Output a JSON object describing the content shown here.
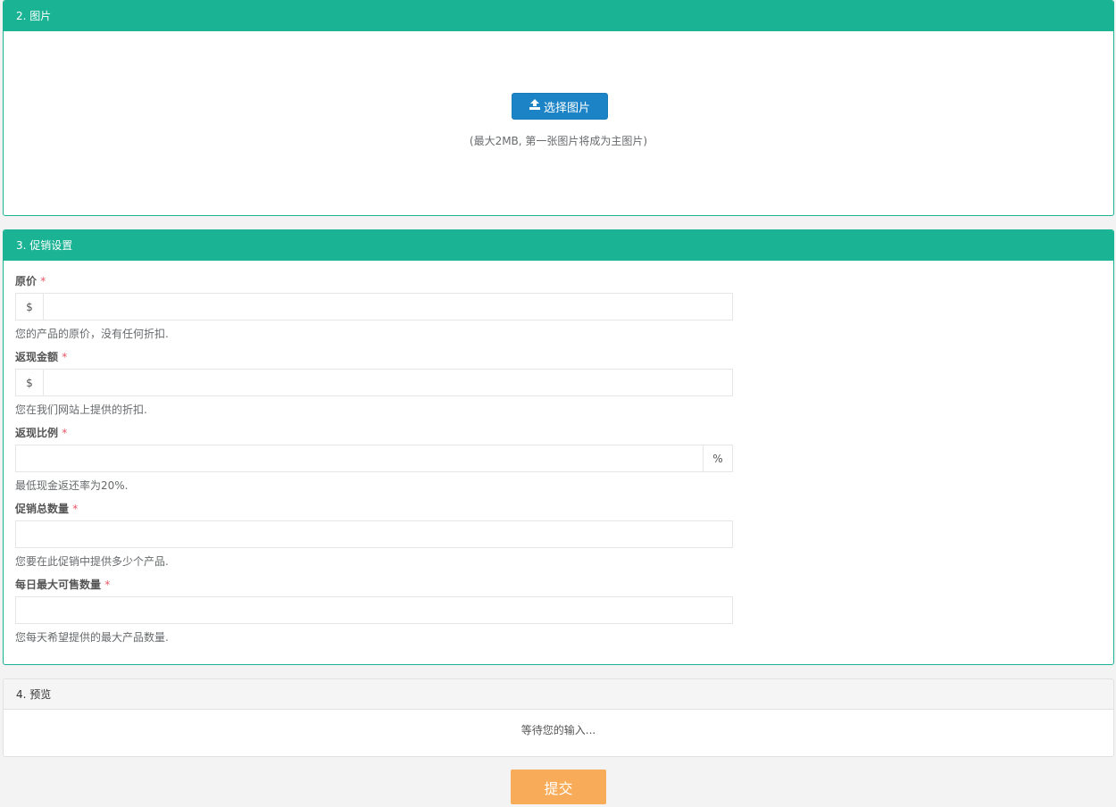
{
  "images_panel": {
    "title": "2. 图片",
    "upload_button": "选择图片",
    "hint": "(最大2MB, 第一张图片将成为主图片)"
  },
  "promo_panel": {
    "title": "3. 促销设置",
    "fields": [
      {
        "label": "原价",
        "required": "*",
        "prefix": "$",
        "value": "",
        "help": "您的产品的原价，没有任何折扣."
      },
      {
        "label": "返现金额",
        "required": "*",
        "prefix": "$",
        "value": "",
        "help": "您在我们网站上提供的折扣."
      },
      {
        "label": "返现比例",
        "required": "*",
        "suffix": "%",
        "value": "",
        "help": "最低现金返还率为20%."
      },
      {
        "label": "促销总数量",
        "required": "*",
        "value": "",
        "help": "您要在此促销中提供多少个产品."
      },
      {
        "label": "每日最大可售数量",
        "required": "*",
        "value": "",
        "help": "您每天希望提供的最大产品数量."
      }
    ]
  },
  "preview_panel": {
    "title": "4. 预览",
    "placeholder_text": "等待您的输入..."
  },
  "submit_button": "提交",
  "colors": {
    "header_green": "#1ab394",
    "primary_blue": "#1c84c6",
    "submit_orange": "#f8ac59",
    "required_red": "#ed5565"
  },
  "icons": {
    "upload": "upload-icon"
  }
}
